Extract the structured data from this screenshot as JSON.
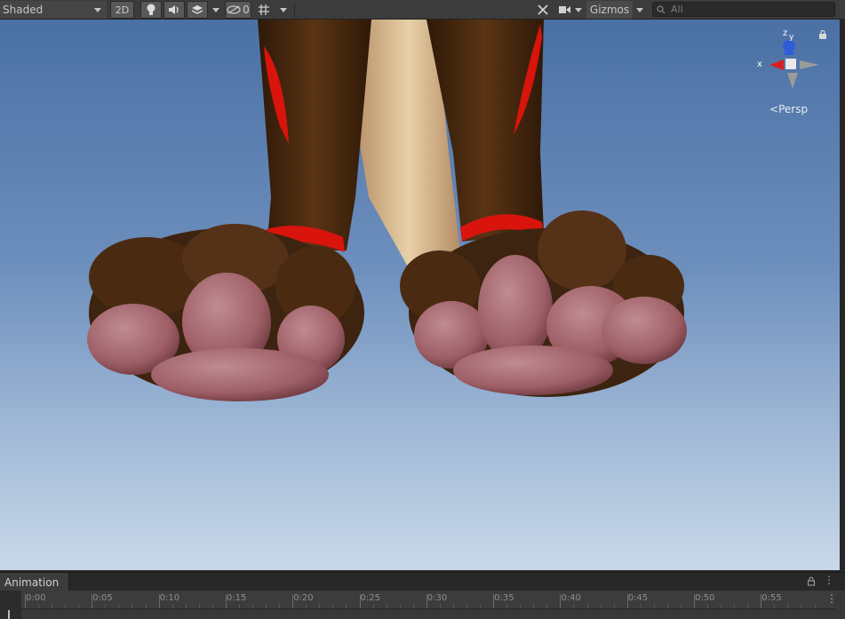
{
  "toolbar": {
    "shading_mode": "Shaded",
    "mode_2d": "2D",
    "hidden_count": "0",
    "gizmos": "Gizmos",
    "search_placeholder": "All"
  },
  "scene": {
    "gizmo": {
      "z_label": "z",
      "y_label": "y",
      "x_label": "x",
      "projection": "Persp"
    }
  },
  "animation": {
    "tab_label": "Animation",
    "timeline_labels": [
      "0:00",
      "0:05",
      "0:10",
      "0:15",
      "0:20",
      "0:25",
      "0:30",
      "0:35",
      "0:40",
      "0:45",
      "0:50",
      "0:55"
    ]
  },
  "colors": {
    "sky_top": "#4a70a4",
    "sky_bottom": "#c9d8e8",
    "fur": "#4a2b12",
    "band": "#d8140c",
    "pads": "#a86a72"
  },
  "icons": [
    "lightbulb-icon",
    "audio-icon",
    "effects-icon",
    "visibility-icon",
    "grid-icon",
    "tools-icon",
    "camera-icon",
    "search-icon",
    "lock-icon",
    "more-icon"
  ]
}
